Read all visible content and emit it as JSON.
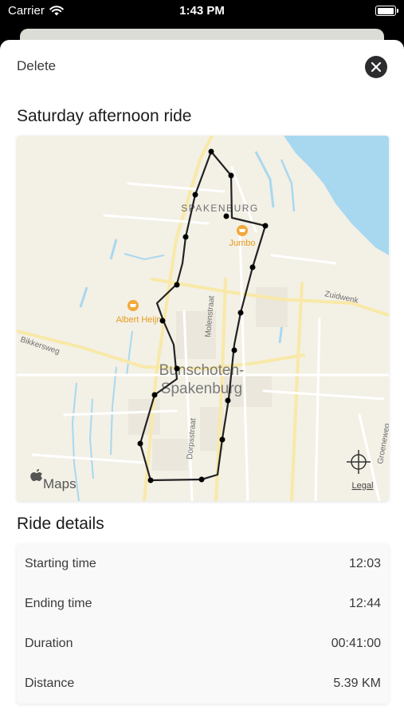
{
  "status_bar": {
    "carrier": "Carrier",
    "time": "1:43 PM",
    "battery_level": 1.0
  },
  "sheet": {
    "delete_label": "Delete",
    "close_icon": "close-icon",
    "title": "Saturday afternoon ride"
  },
  "map": {
    "labels": {
      "spakenburg": "SPAKENBURG",
      "town_line1": "Bunschoten-",
      "town_line2": "Spakenburg",
      "jumbo": "Jumbo",
      "albert_heijn": "Albert Heijn",
      "molenstraat": "Molenstraat",
      "dorpsstraat": "Dorpsstraat",
      "zuidwenk": "Zuidwenk",
      "bikkersweg": "Bikkersweg",
      "groeneweg": "Groeneweg"
    },
    "maps_logo": "Maps",
    "legal": "Legal",
    "recenter_icon": "crosshair-icon",
    "water_color": "#a8d8f0",
    "route_color": "#222222"
  },
  "details": {
    "title": "Ride details",
    "rows": [
      {
        "label": "Starting time",
        "value": "12:03"
      },
      {
        "label": "Ending time",
        "value": "12:44"
      },
      {
        "label": "Duration",
        "value": "00:41:00"
      },
      {
        "label": "Distance",
        "value": "5.39 KM"
      }
    ]
  }
}
